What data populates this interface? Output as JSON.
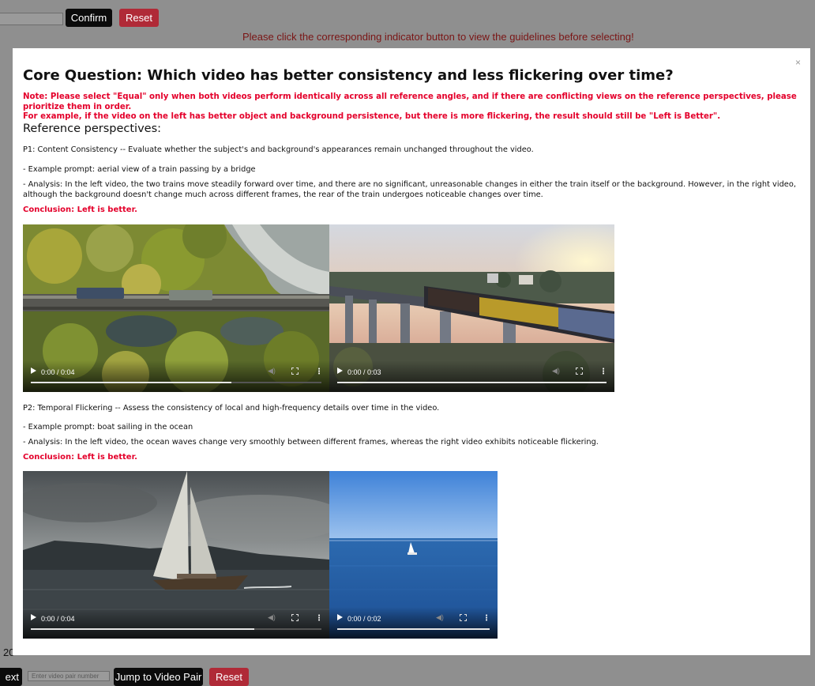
{
  "top": {
    "confirm_label": "Confirm",
    "reset_label": "Reset",
    "notice": "Please click the corresponding indicator button to view the guidelines before selecting!"
  },
  "bottom": {
    "next_fragment": "ext",
    "number_fragment": "20",
    "input_placeholder": "Enter video pair number",
    "jump_label": "Jump to Video Pair",
    "reset_label": "Reset"
  },
  "modal": {
    "close_symbol": "×",
    "title": "Core Question: Which video has better consistency and less flickering over time?",
    "note_line1": "Note: Please select \"Equal\" only when both videos perform identically across all reference angles, and if there are conflicting views on the reference perspectives, please prioritize them in order.",
    "note_line2": "For example, if the video on the left has better object and background persistence, but there is more flickering, the result should still be \"Left is Better\".",
    "reference_title": "Reference perspectives:",
    "p1": {
      "heading": "P1: Content Consistency -- Evaluate whether the subject's and background's appearances remain unchanged throughout the video.",
      "prompt": "- Example prompt: aerial view of a train passing by a bridge",
      "analysis": "- Analysis: In the left video, the two trains move steadily forward over time, and there are no significant, unreasonable changes in either the train itself or the background. However, in the right video, although the background doesn't change much across different frames, the rear of the train undergoes noticeable changes over time.",
      "conclusion": "Conclusion: Left is better.",
      "videos": [
        {
          "time": "0:00 / 0:04",
          "progress": 0.69
        },
        {
          "time": "0:00 / 0:03",
          "progress": 1.0
        }
      ]
    },
    "p2": {
      "heading": "P2: Temporal Flickering -- Assess the consistency of local and high-frequency details over time in the video.",
      "prompt": "- Example prompt: boat sailing in the ocean",
      "analysis": "- Analysis: In the left video, the ocean waves change very smoothly between different frames, whereas the right video exhibits noticeable flickering.",
      "conclusion": "Conclusion: Left is better.",
      "videos": [
        {
          "time": "0:00 / 0:04",
          "progress": 0.77
        },
        {
          "time": "0:00 / 0:02",
          "progress": 1.0
        }
      ]
    }
  }
}
